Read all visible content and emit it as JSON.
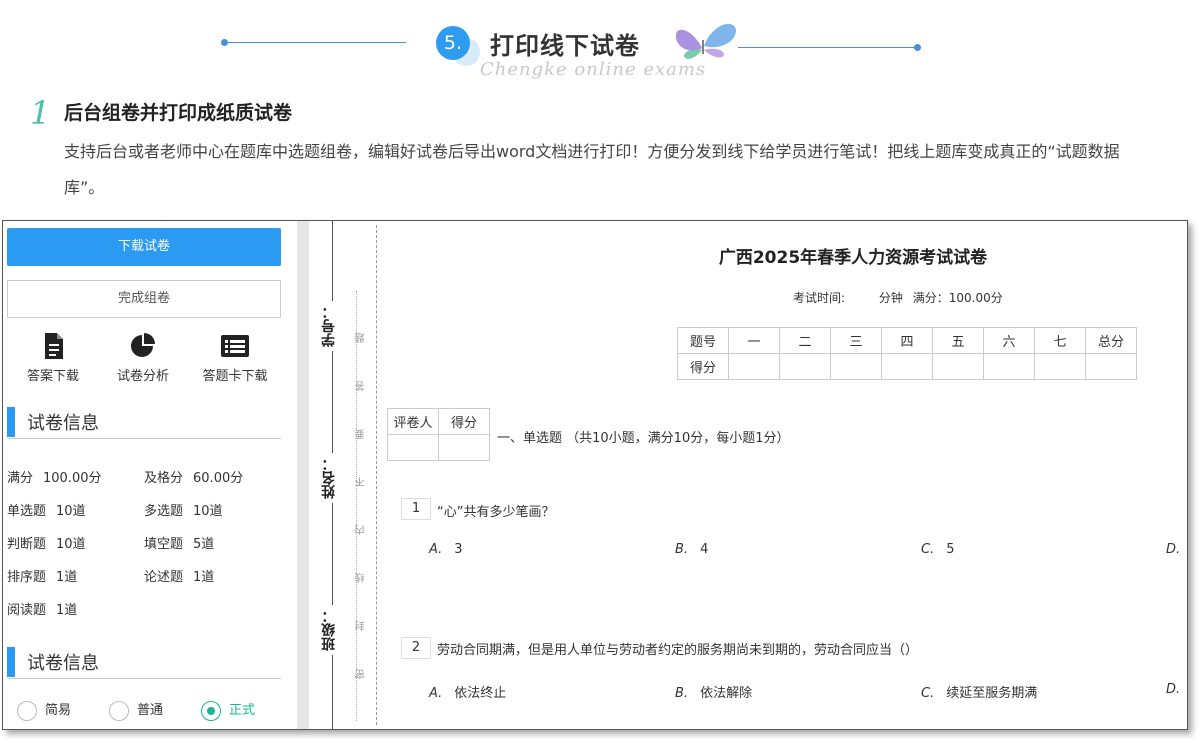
{
  "header": {
    "number": "5.",
    "title": "打印线下试卷",
    "subtitle": "Chengke online exams"
  },
  "section": {
    "number": "1",
    "title": "后台组卷并打印成纸质试卷",
    "description": "支持后台或者老师中心在题库中选题组卷，编辑好试卷后导出word文档进行打印！方便分发到线下给学员进行笔试！把线上题库变成真正的“试题数据库”。"
  },
  "left_panel": {
    "download_button": "下载试卷",
    "finish_button": "完成组卷",
    "tools": [
      {
        "label": "答案下载",
        "icon": "document-icon"
      },
      {
        "label": "试卷分析",
        "icon": "pie-chart-icon"
      },
      {
        "label": "答题卡下载",
        "icon": "list-card-icon"
      }
    ],
    "info_heading": "试卷信息",
    "info": [
      {
        "k": "满分",
        "v": "100.00分"
      },
      {
        "k": "及格分",
        "v": "60.00分"
      },
      {
        "k": "单选题",
        "v": "10道"
      },
      {
        "k": "多选题",
        "v": "10道"
      },
      {
        "k": "判断题",
        "v": "10道"
      },
      {
        "k": "填空题",
        "v": "5道"
      },
      {
        "k": "排序题",
        "v": "1道"
      },
      {
        "k": "论述题",
        "v": "1道"
      },
      {
        "k": "阅读题",
        "v": "1道"
      }
    ],
    "style_heading": "试卷信息",
    "styles": [
      {
        "label": "简易",
        "selected": false
      },
      {
        "label": "普通",
        "selected": false
      },
      {
        "label": "正式",
        "selected": true
      }
    ]
  },
  "binding": {
    "labels": [
      "学号：",
      "姓名：",
      "班级："
    ],
    "chars": [
      "题",
      "答",
      "要",
      "不",
      "内",
      "线",
      "封",
      "密"
    ]
  },
  "paper": {
    "title": "广西2025年春季人力资源考试试卷",
    "time_label": "考试时间:",
    "duration": "分钟",
    "full_score": "满分：100.00分",
    "score_table": {
      "header": [
        "题号",
        "一",
        "二",
        "三",
        "四",
        "五",
        "六",
        "七",
        "总分"
      ],
      "row_label": "得分"
    },
    "grader_table": [
      "评卷人",
      "得分"
    ],
    "section_title": "一、单选题 （共10小题，满分10分，每小题1分）",
    "questions": [
      {
        "num": "1",
        "text": "“心”共有多少笔画？",
        "options": [
          {
            "letter": "A.",
            "text": "3"
          },
          {
            "letter": "B.",
            "text": "4"
          },
          {
            "letter": "C.",
            "text": "5"
          },
          {
            "letter": "D.",
            "text": ""
          }
        ]
      },
      {
        "num": "2",
        "text": "劳动合同期满，但是用人单位与劳动者约定的服务期尚未到期的，劳动合同应当（）",
        "options": [
          {
            "letter": "A.",
            "text": "依法终止"
          },
          {
            "letter": "B.",
            "text": "依法解除"
          },
          {
            "letter": "C.",
            "text": "续延至服务期满"
          },
          {
            "letter": "D.",
            "text": ""
          }
        ]
      }
    ]
  },
  "colors": {
    "primary": "#2b9af3",
    "accent_green": "#19b88e",
    "section_number": "#46c0a8"
  }
}
